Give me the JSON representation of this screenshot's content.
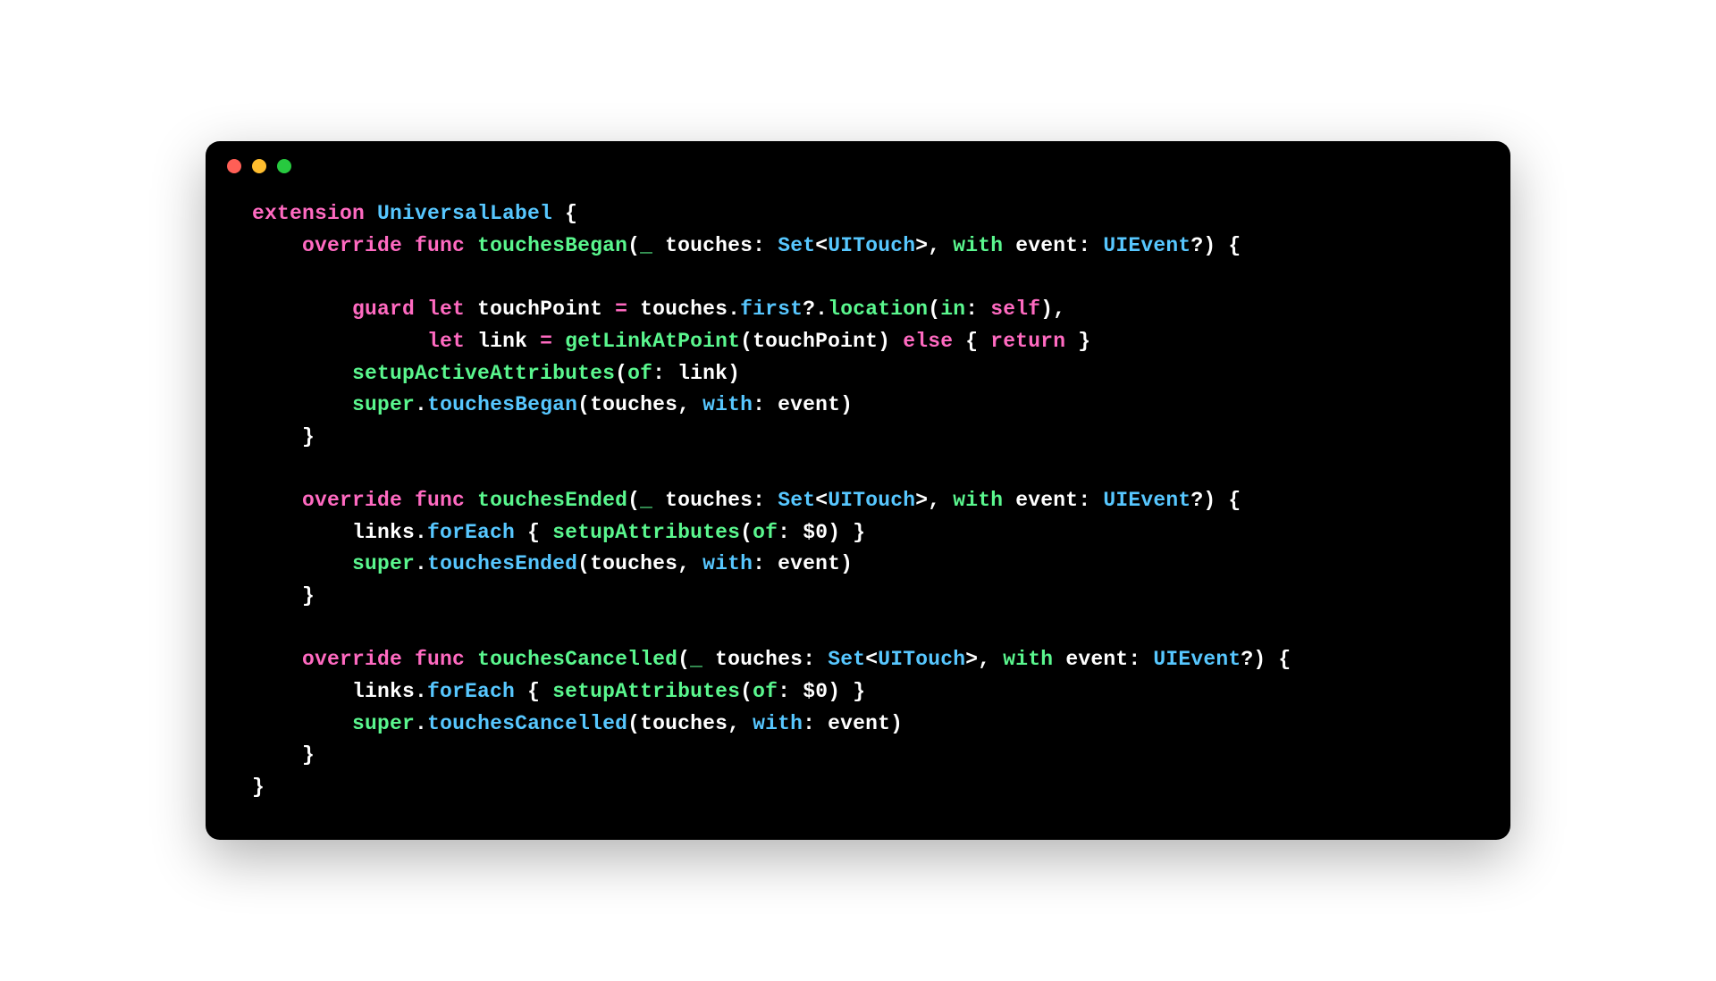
{
  "window": {
    "traffic_lights": [
      "close",
      "minimize",
      "zoom"
    ]
  },
  "code": {
    "lines": [
      [
        {
          "t": "extension ",
          "c": "tok-keyword"
        },
        {
          "t": "UniversalLabel",
          "c": "tok-type"
        },
        {
          "t": " {",
          "c": "tok-white"
        }
      ],
      [
        {
          "t": "    ",
          "c": "tok-white"
        },
        {
          "t": "override func",
          "c": "tok-keyword"
        },
        {
          "t": " ",
          "c": "tok-white"
        },
        {
          "t": "touchesBegan",
          "c": "tok-func"
        },
        {
          "t": "(",
          "c": "tok-white"
        },
        {
          "t": "_",
          "c": "tok-func"
        },
        {
          "t": " ",
          "c": "tok-white"
        },
        {
          "t": "touches",
          "c": "tok-white"
        },
        {
          "t": ": ",
          "c": "tok-white"
        },
        {
          "t": "Set",
          "c": "tok-type"
        },
        {
          "t": "<",
          "c": "tok-white"
        },
        {
          "t": "UITouch",
          "c": "tok-type"
        },
        {
          "t": ">, ",
          "c": "tok-white"
        },
        {
          "t": "with",
          "c": "tok-func"
        },
        {
          "t": " ",
          "c": "tok-white"
        },
        {
          "t": "event",
          "c": "tok-white"
        },
        {
          "t": ": ",
          "c": "tok-white"
        },
        {
          "t": "UIEvent",
          "c": "tok-type"
        },
        {
          "t": "?) {",
          "c": "tok-white"
        }
      ],
      [
        {
          "t": " ",
          "c": "tok-white"
        }
      ],
      [
        {
          "t": "        ",
          "c": "tok-white"
        },
        {
          "t": "guard let",
          "c": "tok-keyword"
        },
        {
          "t": " touchPoint ",
          "c": "tok-white"
        },
        {
          "t": "=",
          "c": "tok-keyword"
        },
        {
          "t": " touches.",
          "c": "tok-white"
        },
        {
          "t": "first",
          "c": "tok-method"
        },
        {
          "t": "?",
          "c": "tok-white"
        },
        {
          "t": ".",
          "c": "tok-white"
        },
        {
          "t": "location",
          "c": "tok-func"
        },
        {
          "t": "(",
          "c": "tok-white"
        },
        {
          "t": "in",
          "c": "tok-func"
        },
        {
          "t": ": ",
          "c": "tok-white"
        },
        {
          "t": "self",
          "c": "tok-keyword"
        },
        {
          "t": "),",
          "c": "tok-white"
        }
      ],
      [
        {
          "t": "              ",
          "c": "tok-white"
        },
        {
          "t": "let",
          "c": "tok-keyword"
        },
        {
          "t": " link ",
          "c": "tok-white"
        },
        {
          "t": "=",
          "c": "tok-keyword"
        },
        {
          "t": " ",
          "c": "tok-white"
        },
        {
          "t": "getLinkAtPoint",
          "c": "tok-func"
        },
        {
          "t": "(touchPoint) ",
          "c": "tok-white"
        },
        {
          "t": "else",
          "c": "tok-keyword"
        },
        {
          "t": " { ",
          "c": "tok-white"
        },
        {
          "t": "return",
          "c": "tok-keyword"
        },
        {
          "t": " }",
          "c": "tok-white"
        }
      ],
      [
        {
          "t": "        ",
          "c": "tok-white"
        },
        {
          "t": "setupActiveAttributes",
          "c": "tok-func"
        },
        {
          "t": "(",
          "c": "tok-white"
        },
        {
          "t": "of",
          "c": "tok-func"
        },
        {
          "t": ": link)",
          "c": "tok-white"
        }
      ],
      [
        {
          "t": "        ",
          "c": "tok-white"
        },
        {
          "t": "super",
          "c": "tok-func"
        },
        {
          "t": ".",
          "c": "tok-white"
        },
        {
          "t": "touchesBegan",
          "c": "tok-method"
        },
        {
          "t": "(touches, ",
          "c": "tok-white"
        },
        {
          "t": "with",
          "c": "tok-method"
        },
        {
          "t": ": event)",
          "c": "tok-white"
        }
      ],
      [
        {
          "t": "    }",
          "c": "tok-white"
        }
      ],
      [
        {
          "t": " ",
          "c": "tok-white"
        }
      ],
      [
        {
          "t": "    ",
          "c": "tok-white"
        },
        {
          "t": "override func",
          "c": "tok-keyword"
        },
        {
          "t": " ",
          "c": "tok-white"
        },
        {
          "t": "touchesEnded",
          "c": "tok-func"
        },
        {
          "t": "(",
          "c": "tok-white"
        },
        {
          "t": "_",
          "c": "tok-func"
        },
        {
          "t": " ",
          "c": "tok-white"
        },
        {
          "t": "touches",
          "c": "tok-white"
        },
        {
          "t": ": ",
          "c": "tok-white"
        },
        {
          "t": "Set",
          "c": "tok-type"
        },
        {
          "t": "<",
          "c": "tok-white"
        },
        {
          "t": "UITouch",
          "c": "tok-type"
        },
        {
          "t": ">, ",
          "c": "tok-white"
        },
        {
          "t": "with",
          "c": "tok-func"
        },
        {
          "t": " ",
          "c": "tok-white"
        },
        {
          "t": "event",
          "c": "tok-white"
        },
        {
          "t": ": ",
          "c": "tok-white"
        },
        {
          "t": "UIEvent",
          "c": "tok-type"
        },
        {
          "t": "?) {",
          "c": "tok-white"
        }
      ],
      [
        {
          "t": "        links.",
          "c": "tok-white"
        },
        {
          "t": "forEach",
          "c": "tok-method"
        },
        {
          "t": " { ",
          "c": "tok-white"
        },
        {
          "t": "setupAttributes",
          "c": "tok-func"
        },
        {
          "t": "(",
          "c": "tok-white"
        },
        {
          "t": "of",
          "c": "tok-func"
        },
        {
          "t": ": ",
          "c": "tok-white"
        },
        {
          "t": "$0",
          "c": "tok-white"
        },
        {
          "t": ") }",
          "c": "tok-white"
        }
      ],
      [
        {
          "t": "        ",
          "c": "tok-white"
        },
        {
          "t": "super",
          "c": "tok-func"
        },
        {
          "t": ".",
          "c": "tok-white"
        },
        {
          "t": "touchesEnded",
          "c": "tok-method"
        },
        {
          "t": "(touches, ",
          "c": "tok-white"
        },
        {
          "t": "with",
          "c": "tok-method"
        },
        {
          "t": ": event)",
          "c": "tok-white"
        }
      ],
      [
        {
          "t": "    }",
          "c": "tok-white"
        }
      ],
      [
        {
          "t": " ",
          "c": "tok-white"
        }
      ],
      [
        {
          "t": "    ",
          "c": "tok-white"
        },
        {
          "t": "override func",
          "c": "tok-keyword"
        },
        {
          "t": " ",
          "c": "tok-white"
        },
        {
          "t": "touchesCancelled",
          "c": "tok-func"
        },
        {
          "t": "(",
          "c": "tok-white"
        },
        {
          "t": "_",
          "c": "tok-func"
        },
        {
          "t": " ",
          "c": "tok-white"
        },
        {
          "t": "touches",
          "c": "tok-white"
        },
        {
          "t": ": ",
          "c": "tok-white"
        },
        {
          "t": "Set",
          "c": "tok-type"
        },
        {
          "t": "<",
          "c": "tok-white"
        },
        {
          "t": "UITouch",
          "c": "tok-type"
        },
        {
          "t": ">, ",
          "c": "tok-white"
        },
        {
          "t": "with",
          "c": "tok-func"
        },
        {
          "t": " ",
          "c": "tok-white"
        },
        {
          "t": "event",
          "c": "tok-white"
        },
        {
          "t": ": ",
          "c": "tok-white"
        },
        {
          "t": "UIEvent",
          "c": "tok-type"
        },
        {
          "t": "?) {",
          "c": "tok-white"
        }
      ],
      [
        {
          "t": "        links.",
          "c": "tok-white"
        },
        {
          "t": "forEach",
          "c": "tok-method"
        },
        {
          "t": " { ",
          "c": "tok-white"
        },
        {
          "t": "setupAttributes",
          "c": "tok-func"
        },
        {
          "t": "(",
          "c": "tok-white"
        },
        {
          "t": "of",
          "c": "tok-func"
        },
        {
          "t": ": ",
          "c": "tok-white"
        },
        {
          "t": "$0",
          "c": "tok-white"
        },
        {
          "t": ") }",
          "c": "tok-white"
        }
      ],
      [
        {
          "t": "        ",
          "c": "tok-white"
        },
        {
          "t": "super",
          "c": "tok-func"
        },
        {
          "t": ".",
          "c": "tok-white"
        },
        {
          "t": "touchesCancelled",
          "c": "tok-method"
        },
        {
          "t": "(touches, ",
          "c": "tok-white"
        },
        {
          "t": "with",
          "c": "tok-method"
        },
        {
          "t": ": event)",
          "c": "tok-white"
        }
      ],
      [
        {
          "t": "    }",
          "c": "tok-white"
        }
      ],
      [
        {
          "t": "}",
          "c": "tok-white"
        }
      ]
    ]
  }
}
